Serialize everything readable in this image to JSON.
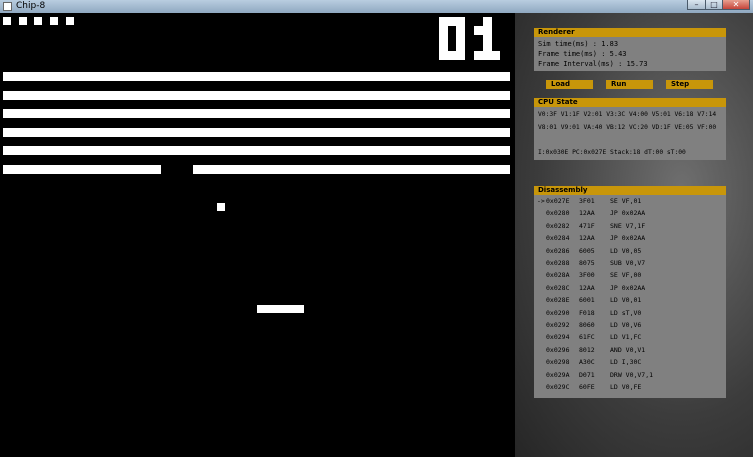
{
  "window": {
    "title": "Chip-8",
    "controls": {
      "minimize": "–",
      "maximize": "□",
      "close": "✕"
    }
  },
  "game": {
    "score": "01",
    "lives": 5
  },
  "renderer": {
    "header": "Renderer",
    "sim_time": "Sim time(ms) : 1.83",
    "frame_time": "Frame time(ms) : 5.43",
    "frame_interval": "Frame Interval(ms) : 15.73"
  },
  "controls": {
    "load": "Load",
    "run": "Run",
    "step": "Step"
  },
  "cpu": {
    "header": "CPU State",
    "regs_line1": "V0:3F V1:1F V2:01 V3:3C V4:00 V5:01 V6:18 V7:14",
    "regs_line2": "V8:01 V9:01 VA:40 VB:12 VC:20 VD:1F VE:05 VF:00",
    "status_line": "I:0x030E PC:0x027E Stack:18 dT:00 sT:00"
  },
  "disassembly": {
    "header": "Disassembly",
    "rows": [
      {
        "marker": "->",
        "addr": "0x027E",
        "op": "3F01",
        "instr": "SE VF,01"
      },
      {
        "marker": "",
        "addr": "0x0280",
        "op": "12AA",
        "instr": "JP 0x02AA"
      },
      {
        "marker": "",
        "addr": "0x0282",
        "op": "471F",
        "instr": "SNE V7,1F"
      },
      {
        "marker": "",
        "addr": "0x0284",
        "op": "12AA",
        "instr": "JP 0x02AA"
      },
      {
        "marker": "",
        "addr": "0x0286",
        "op": "6005",
        "instr": "LD V0,05"
      },
      {
        "marker": "",
        "addr": "0x0288",
        "op": "8075",
        "instr": "SUB V0,V7"
      },
      {
        "marker": "",
        "addr": "0x028A",
        "op": "3F00",
        "instr": "SE VF,00"
      },
      {
        "marker": "",
        "addr": "0x028C",
        "op": "12AA",
        "instr": "JP 0x02AA"
      },
      {
        "marker": "",
        "addr": "0x028E",
        "op": "6001",
        "instr": "LD V0,01"
      },
      {
        "marker": "",
        "addr": "0x0290",
        "op": "F018",
        "instr": "LD sT,V0"
      },
      {
        "marker": "",
        "addr": "0x0292",
        "op": "8060",
        "instr": "LD V0,V6"
      },
      {
        "marker": "",
        "addr": "0x0294",
        "op": "61FC",
        "instr": "LD V1,FC"
      },
      {
        "marker": "",
        "addr": "0x0296",
        "op": "8012",
        "instr": "AND V0,V1"
      },
      {
        "marker": "",
        "addr": "0x0298",
        "op": "A30C",
        "instr": "LD I,30C"
      },
      {
        "marker": "",
        "addr": "0x029A",
        "op": "D071",
        "instr": "DRW V0,V7,1"
      },
      {
        "marker": "",
        "addr": "0x029C",
        "op": "60FE",
        "instr": "LD V0,FE"
      }
    ]
  }
}
